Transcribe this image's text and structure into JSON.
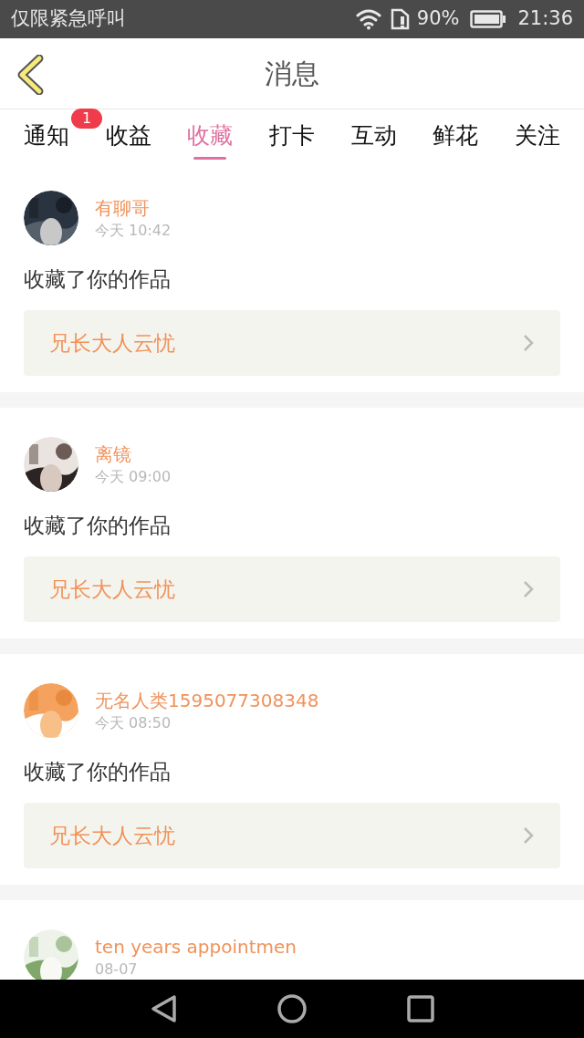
{
  "status_bar": {
    "carrier": "仅限紧急呼叫",
    "battery": "90%",
    "time": "21:36"
  },
  "header": {
    "title": "消息"
  },
  "tabs": [
    {
      "label": "通知",
      "selected": false,
      "badge": "1"
    },
    {
      "label": "收益",
      "selected": false
    },
    {
      "label": "收藏",
      "selected": true
    },
    {
      "label": "打卡",
      "selected": false
    },
    {
      "label": "互动",
      "selected": false
    },
    {
      "label": "鲜花",
      "selected": false
    },
    {
      "label": "关注",
      "selected": false
    }
  ],
  "messages": [
    {
      "user": "有聊哥",
      "time": "今天 10:42",
      "text": "收藏了你的作品",
      "work": "兄长大人云忧"
    },
    {
      "user": "离镜",
      "time": "今天 09:00",
      "text": "收藏了你的作品",
      "work": "兄长大人云忧"
    },
    {
      "user": "无名人类1595077308348",
      "time": "今天 08:50",
      "text": "收藏了你的作品",
      "work": "兄长大人云忧"
    },
    {
      "user": "ten years appointmen",
      "time": "08-07"
    }
  ]
}
